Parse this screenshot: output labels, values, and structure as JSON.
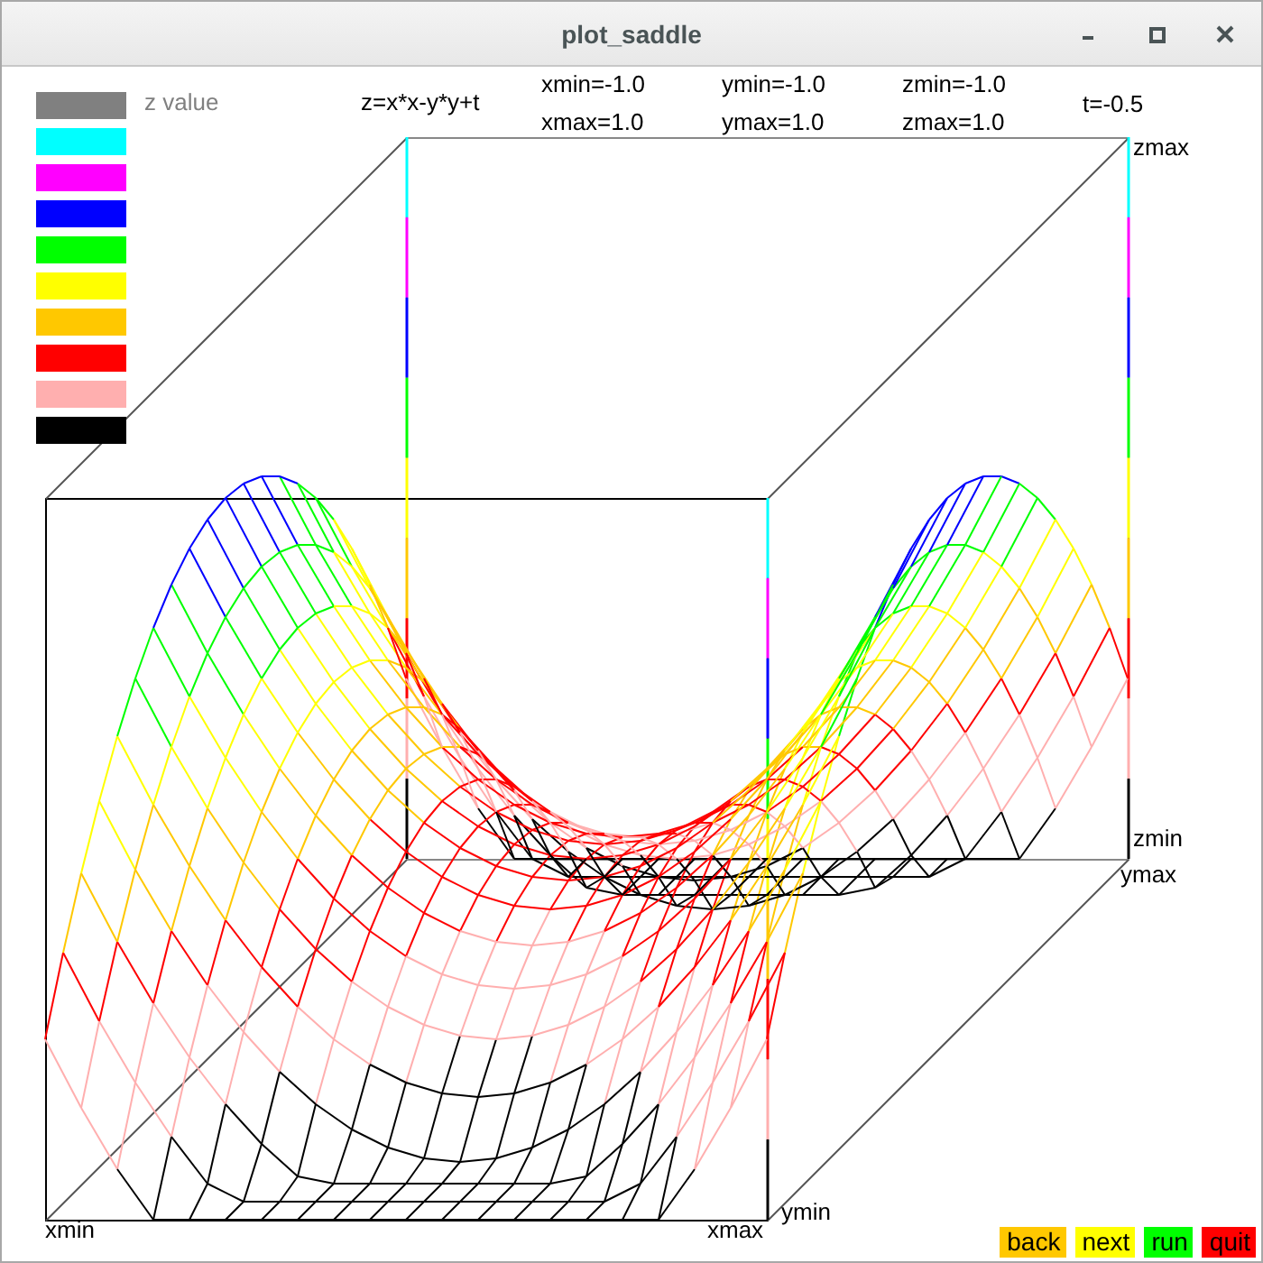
{
  "window": {
    "title": "plot_saddle"
  },
  "legend": {
    "label": "z value",
    "swatches": [
      {
        "color": "#808080"
      },
      {
        "color": "#00ffff"
      },
      {
        "color": "#ff00ff"
      },
      {
        "color": "#0000ff"
      },
      {
        "color": "#00ff00"
      },
      {
        "color": "#ffff00"
      },
      {
        "color": "#ffc800"
      },
      {
        "color": "#ff0000"
      },
      {
        "color": "#ffafaf"
      },
      {
        "color": "#000000"
      }
    ]
  },
  "header": {
    "formula": "z=x*x-y*y+t",
    "ranges": [
      {
        "min": "xmin=-1.0",
        "max": "xmax=1.0"
      },
      {
        "min": "ymin=-1.0",
        "max": "ymax=1.0"
      },
      {
        "min": "zmin=-1.0",
        "max": "zmax=1.0"
      }
    ],
    "time": "t=-0.5"
  },
  "axis_labels": {
    "zmax": "zmax",
    "zmin": "zmin",
    "ymax": "ymax",
    "ymin": "ymin",
    "xmin": "xmin",
    "xmax": "xmax"
  },
  "buttons": [
    {
      "label": "back",
      "color": "#ffc800"
    },
    {
      "label": "next",
      "color": "#ffff00"
    },
    {
      "label": "run",
      "color": "#00ff00"
    },
    {
      "label": "quit",
      "color": "#ff0000"
    }
  ]
}
